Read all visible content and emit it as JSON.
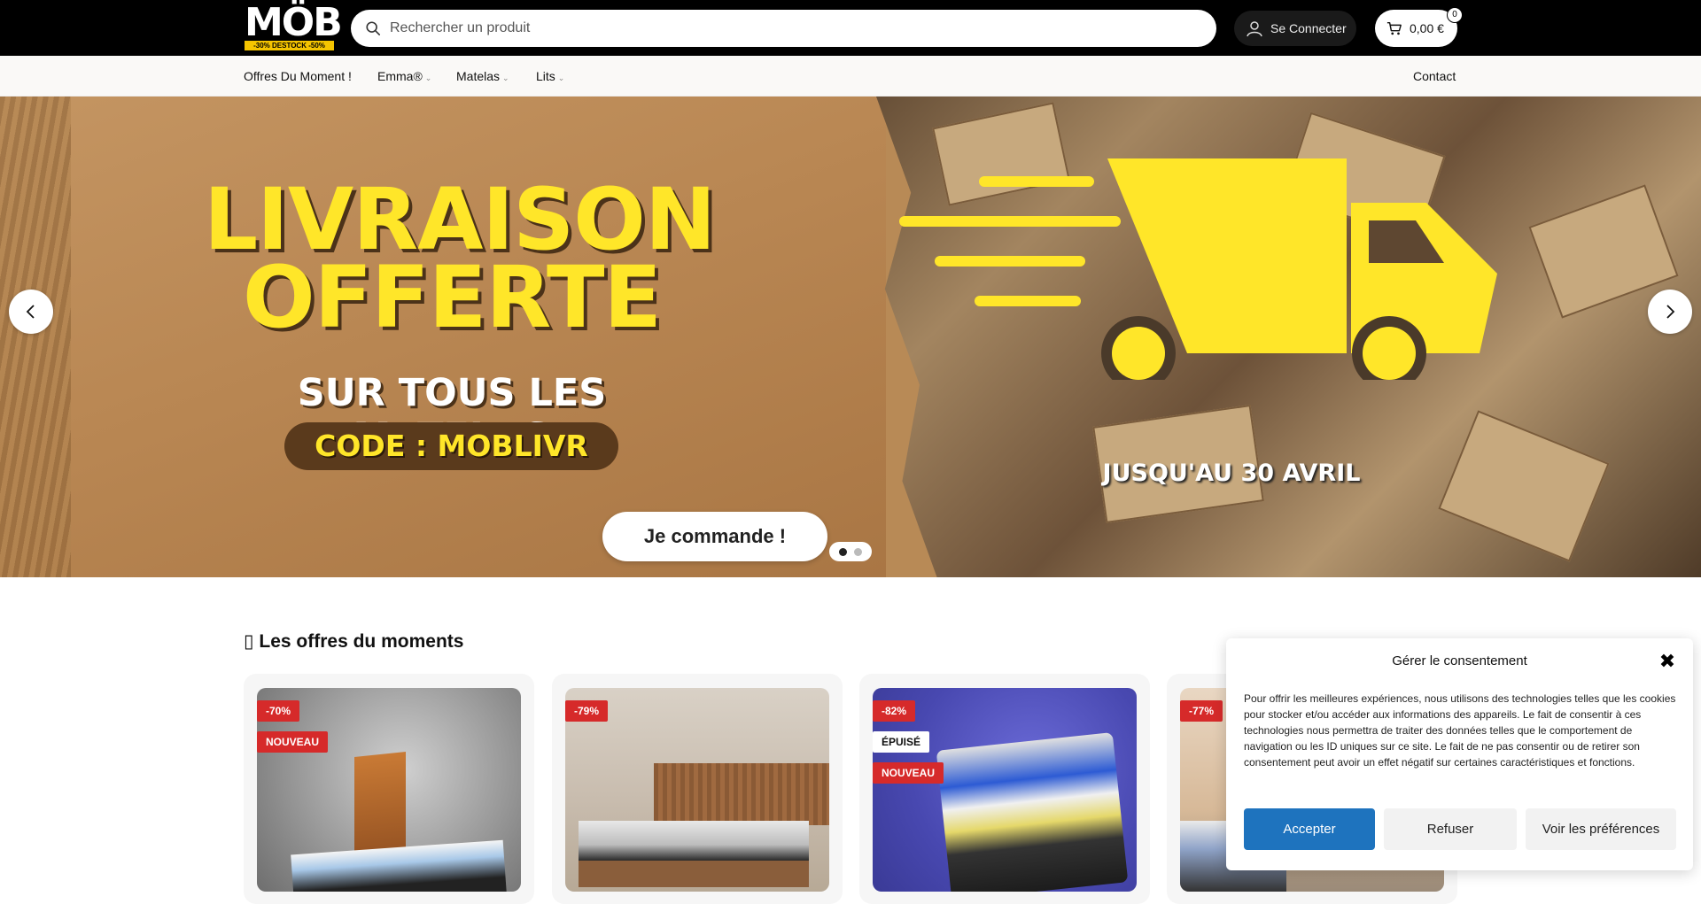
{
  "header": {
    "logo": {
      "name": "MÖB",
      "tagline": "-30% DESTOCK -50%"
    },
    "search": {
      "placeholder": "Rechercher un produit"
    },
    "login_label": "Se Connecter",
    "cart": {
      "amount": "0,00 €",
      "count": "0"
    }
  },
  "nav": {
    "items": [
      {
        "label": "Offres Du Moment !"
      },
      {
        "label": "Emma®"
      },
      {
        "label": "Matelas"
      },
      {
        "label": "Lits"
      }
    ],
    "contact": "Contact"
  },
  "hero": {
    "line1": "LIVRAISON",
    "line2": "OFFERTE",
    "line3": "SUR TOUS LES MATELAS",
    "code": "CODE : MOBLIVR",
    "until": "JUSQU'AU 30 AVRIL",
    "cta": "Je commande !",
    "slides": 2,
    "active_slide": 1
  },
  "offers": {
    "title": "Les offres du moments",
    "cards": [
      {
        "badges": [
          "-70%",
          "NOUVEAU"
        ]
      },
      {
        "badges": [
          "-79%"
        ]
      },
      {
        "badges": [
          "-82%",
          "ÉPUISÉ",
          "NOUVEAU"
        ]
      },
      {
        "badges": [
          "-77%"
        ]
      }
    ]
  },
  "consent": {
    "title": "Gérer le consentement",
    "body": "Pour offrir les meilleures expériences, nous utilisons des technologies telles que les cookies pour stocker et/ou accéder aux informations des appareils. Le fait de consentir à ces technologies nous permettra de traiter des données telles que le comportement de navigation ou les ID uniques sur ce site. Le fait de ne pas consentir ou de retirer son consentement peut avoir un effet négatif sur certaines caractéristiques et fonctions.",
    "accept": "Accepter",
    "refuse": "Refuser",
    "preferences": "Voir les préférences"
  },
  "colors": {
    "topbar": "#000000",
    "hero_yellow": "#ffe629",
    "badge_red": "#d62a2a",
    "accept_blue": "#1e73be"
  }
}
